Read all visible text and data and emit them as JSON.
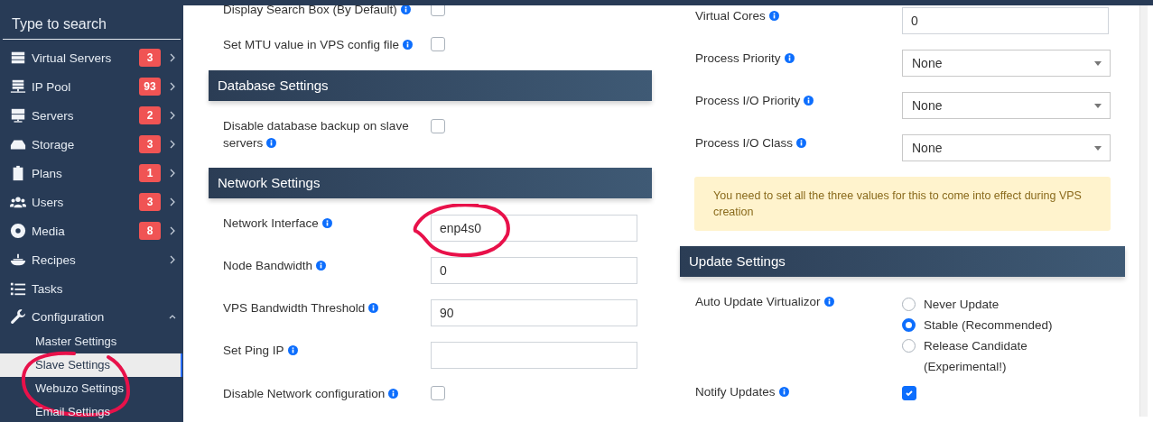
{
  "sidebar": {
    "search": {
      "placeholder": "Type to search"
    },
    "items": [
      {
        "label": "Virtual Servers",
        "badge": "3",
        "expanded": false
      },
      {
        "label": "IP Pool",
        "badge": "93",
        "expanded": false
      },
      {
        "label": "Servers",
        "badge": "2",
        "expanded": false
      },
      {
        "label": "Storage",
        "badge": "3",
        "expanded": false
      },
      {
        "label": "Plans",
        "badge": "1",
        "expanded": false
      },
      {
        "label": "Users",
        "badge": "3",
        "expanded": false
      },
      {
        "label": "Media",
        "badge": "8",
        "expanded": false
      },
      {
        "label": "Recipes",
        "expanded": false
      },
      {
        "label": "Tasks"
      },
      {
        "label": "Configuration",
        "expanded": true,
        "children": [
          {
            "label": "Master Settings",
            "selected": false
          },
          {
            "label": "Slave Settings",
            "selected": true,
            "highlighted": true
          },
          {
            "label": "Webuzo Settings",
            "selected": false
          },
          {
            "label": "Email Settings",
            "selected": false
          }
        ]
      }
    ]
  },
  "left_column": [
    {
      "kind": "checkbox",
      "label": "Display Search Box (By Default)",
      "checked": false
    },
    {
      "kind": "checkbox",
      "label": "Set MTU value in VPS config file",
      "checked": false
    },
    {
      "kind": "header",
      "title": "Database Settings"
    },
    {
      "kind": "checkbox",
      "label": "Disable database backup on slave servers",
      "checked": false
    },
    {
      "kind": "header",
      "title": "Network Settings"
    },
    {
      "kind": "input",
      "label": "Network Interface",
      "value": "enp4s0",
      "highlighted": true
    },
    {
      "kind": "input",
      "label": "Node Bandwidth",
      "value": "0"
    },
    {
      "kind": "input",
      "label": "VPS Bandwidth Threshold",
      "value": "90"
    },
    {
      "kind": "input",
      "label": "Set Ping IP"
    },
    {
      "kind": "checkbox",
      "label": "Disable Network configuration",
      "checked": false
    }
  ],
  "right_column": [
    {
      "kind": "input",
      "label": "Virtual Cores",
      "value": "0"
    },
    {
      "kind": "select",
      "label": "Process Priority",
      "value": "None"
    },
    {
      "kind": "select",
      "label": "Process I/O Priority",
      "value": "None"
    },
    {
      "kind": "select",
      "label": "Process I/O Class",
      "value": "None"
    },
    {
      "kind": "alert",
      "text": "You need to set all the three values for this to come into effect during VPS creation"
    },
    {
      "kind": "header",
      "title": "Update Settings"
    },
    {
      "kind": "radio",
      "label": "Auto Update Virtualizor",
      "options": [
        {
          "label": "Never Update",
          "selected": false
        },
        {
          "label": "Stable (Recommended)",
          "selected": true
        },
        {
          "label": "Release Candidate (Experimental!)",
          "selected": false
        }
      ]
    },
    {
      "kind": "checkbox",
      "label": "Notify Updates",
      "checked": true
    }
  ]
}
